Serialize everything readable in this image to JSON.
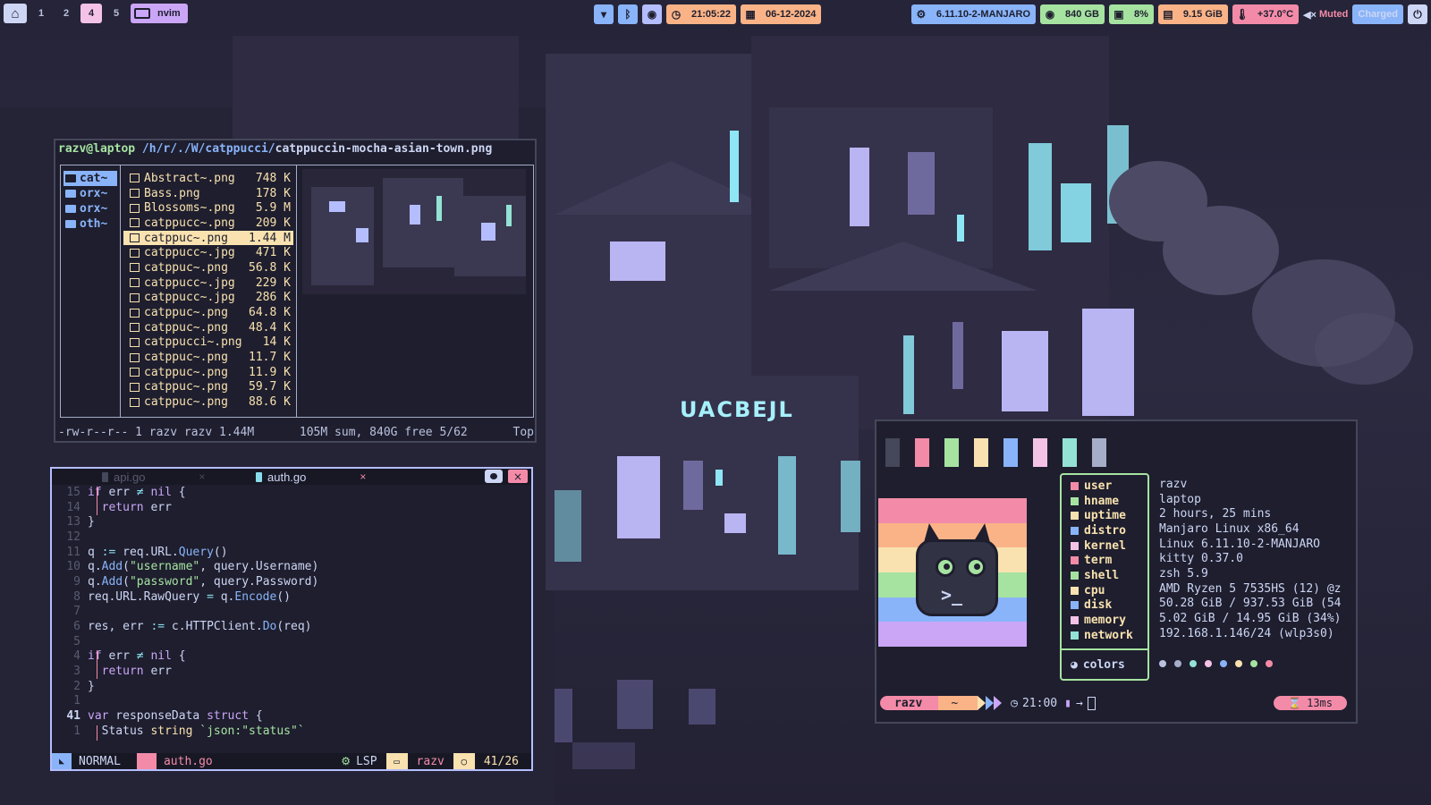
{
  "topbar": {
    "workspaces": [
      "1",
      "2",
      "4",
      "5"
    ],
    "active_workspace": "4",
    "active_app": "nvim",
    "clock": "21:05:22",
    "date": "06-12-2024",
    "kernel": "6.11.10-2-MANJARO",
    "disk": "840 GB",
    "cpu": "8%",
    "memory": "9.15 GiB",
    "temperature": "+37.0°C",
    "volume": "Muted",
    "battery": "Charged",
    "icons": [
      "home-icon",
      "monitor-icon",
      "wifi-icon",
      "bluetooth-icon",
      "discord-icon",
      "clock-icon",
      "calendar-icon",
      "chip-icon",
      "disk-icon",
      "cpu-icon",
      "memory-icon",
      "thermometer-icon",
      "speaker-muted-icon",
      "power-icon"
    ],
    "colors": {
      "bar_chip_blue": "#89b4fa",
      "bar_chip_pink": "#f5c2e7",
      "bar_chip_peach": "#fab387",
      "bar_chip_green": "#a6e3a1",
      "bar_chip_red": "#f38ba8",
      "bar_chip_mauve": "#cba6f7"
    }
  },
  "filemanager": {
    "path_user": "razv@laptop",
    "path_dirs": "/h/r/./W/catppucci/",
    "path_file": "catppuccin-mocha-asian-town.png",
    "dirs": [
      {
        "name": "cat~",
        "selected": true
      },
      {
        "name": "orx~",
        "selected": false
      },
      {
        "name": "orx~",
        "selected": false
      },
      {
        "name": "oth~",
        "selected": false
      }
    ],
    "files": [
      {
        "name": "Abstract~.png",
        "size": "748 K",
        "selected": false
      },
      {
        "name": "Bass.png",
        "size": "178 K",
        "selected": false
      },
      {
        "name": "Blossoms~.png",
        "size": "5.9 M",
        "selected": false
      },
      {
        "name": "catppucc~.png",
        "size": "209 K",
        "selected": false
      },
      {
        "name": "catppuc~.png",
        "size": "1.44 M",
        "selected": true
      },
      {
        "name": "catppucc~.jpg",
        "size": "471 K",
        "selected": false
      },
      {
        "name": "catppuc~.png",
        "size": "56.8 K",
        "selected": false
      },
      {
        "name": "catppucc~.jpg",
        "size": "229 K",
        "selected": false
      },
      {
        "name": "catppucc~.jpg",
        "size": "286 K",
        "selected": false
      },
      {
        "name": "catppuc~.png",
        "size": "64.8 K",
        "selected": false
      },
      {
        "name": "catppuc~.png",
        "size": "48.4 K",
        "selected": false
      },
      {
        "name": "catppucci~.png",
        "size": "14 K",
        "selected": false
      },
      {
        "name": "catppuc~.png",
        "size": "11.7 K",
        "selected": false
      },
      {
        "name": "catppuc~.png",
        "size": "11.9 K",
        "selected": false
      },
      {
        "name": "catppuc~.png",
        "size": "59.7 K",
        "selected": false
      },
      {
        "name": "catppuc~.png",
        "size": "88.6 K",
        "selected": false
      }
    ],
    "status_left": "-rw-r--r-- 1 razv razv 1.44M",
    "status_mid": "105M sum, 840G free  5/62",
    "status_right": "Top"
  },
  "editor": {
    "tabs": [
      {
        "name": "api.go",
        "active": false
      },
      {
        "name": "auth.go",
        "active": true
      }
    ],
    "lines": [
      {
        "num": "15",
        "html": "<span class=\"kw\">if</span> err <span class=\"op\">≠</span> <span class=\"kw\">nil</span> {"
      },
      {
        "num": "14",
        "html": "  <span class=\"kw\">return</span> err"
      },
      {
        "num": "13",
        "html": "}"
      },
      {
        "num": "12",
        "html": ""
      },
      {
        "num": "11",
        "html": "q <span class=\"op\">:=</span> req.URL.<span class=\"fn\">Query</span>()"
      },
      {
        "num": "10",
        "html": "q.<span class=\"fn\">Add</span>(<span class=\"str\">\"username\"</span>, query.Username)"
      },
      {
        "num": "9",
        "html": "q.<span class=\"fn\">Add</span>(<span class=\"str\">\"password\"</span>, query.Password)"
      },
      {
        "num": "8",
        "html": "req.URL.RawQuery <span class=\"op\">=</span> q.<span class=\"fn\">Encode</span>()"
      },
      {
        "num": "7",
        "html": ""
      },
      {
        "num": "6",
        "html": "res, err <span class=\"op\">:=</span> c.HTTPClient.<span class=\"fn\">Do</span>(req)"
      },
      {
        "num": "5",
        "html": ""
      },
      {
        "num": "4",
        "html": "<span class=\"kw\">if</span> err <span class=\"op\">≠</span> <span class=\"kw\">nil</span> {"
      },
      {
        "num": "3",
        "html": "  <span class=\"kw\">return</span> err"
      },
      {
        "num": "2",
        "html": "}"
      },
      {
        "num": "1",
        "html": ""
      },
      {
        "num": "41",
        "html": "<span class=\"kw\">var</span> responseData <span class=\"kw\">struct</span> {",
        "current": true
      },
      {
        "num": "1",
        "html": "  Status <span class=\"ty\">string</span> <span class=\"str\">`json:\"status\"`</span>"
      }
    ],
    "mode": "NORMAL",
    "file": "auth.go",
    "lsp": "LSP",
    "cwd": "razv",
    "position": "41/26"
  },
  "fetch": {
    "swatch_colors": [
      "#45475a",
      "#f38ba8",
      "#a6e3a1",
      "#f9e2af",
      "#89b4fa",
      "#f5c2e7",
      "#94e2d5",
      "#a6adc8"
    ],
    "flag_colors": [
      "#f38ba8",
      "#fab387",
      "#f9e2af",
      "#a6e3a1",
      "#89b4fa",
      "#cba6f7"
    ],
    "keys": [
      {
        "label": "user",
        "color": "#f38ba8"
      },
      {
        "label": "hname",
        "color": "#a6e3a1"
      },
      {
        "label": "uptime",
        "color": "#f9e2af"
      },
      {
        "label": "distro",
        "color": "#89b4fa"
      },
      {
        "label": "kernel",
        "color": "#f5c2e7"
      },
      {
        "label": "term",
        "color": "#f38ba8"
      },
      {
        "label": "shell",
        "color": "#a6e3a1"
      },
      {
        "label": "cpu",
        "color": "#f9e2af"
      },
      {
        "label": "disk",
        "color": "#89b4fa"
      },
      {
        "label": "memory",
        "color": "#f5c2e7"
      },
      {
        "label": "network",
        "color": "#94e2d5"
      }
    ],
    "colors_label": "colors",
    "values": [
      "razv",
      "laptop",
      "2 hours, 25 mins",
      "Manjaro Linux x86_64",
      "Linux 6.11.10-2-MANJARO",
      "kitty 0.37.0",
      "zsh 5.9",
      "AMD Ryzen 5 7535HS (12) @z",
      "50.28 GiB / 937.53 GiB (54",
      "5.02 GiB / 14.95 GiB (34%)",
      "192.168.1.146/24 (wlp3s0)"
    ],
    "dot_colors": [
      "#bac2de",
      "#a6adc8",
      "#94e2d5",
      "#f5c2e7",
      "#89b4fa",
      "#f9e2af",
      "#a6e3a1",
      "#f38ba8"
    ],
    "prompt_user": "razv",
    "prompt_dir": "~",
    "prompt_time": "21:00",
    "prompt_duration": "13ms"
  }
}
